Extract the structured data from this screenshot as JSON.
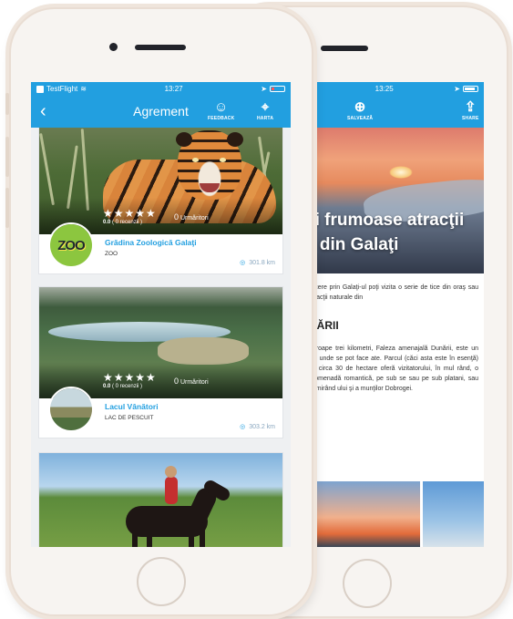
{
  "front": {
    "status": {
      "carrier": "TestFlight",
      "time": "13:27"
    },
    "nav": {
      "back_icon": "back-chevron-icon",
      "title": "Agrement",
      "feedback_label": "FEEDBACK",
      "map_label": "HARTA"
    },
    "cards": [
      {
        "title": "Grădina Zoologică Galaţi",
        "category": "ZOO",
        "distance": "301.8 km",
        "stars": "★★★★★",
        "rating": "0.0",
        "reviews": "( 0 recenzii )",
        "followers_count": "0",
        "followers_label": "Urmăritori",
        "logo_text": "ZOO"
      },
      {
        "title": "Lacul Vânători",
        "category": "LAC DE PESCUIT",
        "distance": "303.2 km",
        "stars": "★★★★★",
        "rating": "0.0",
        "reviews": "( 0 recenzii )",
        "followers_count": "0",
        "followers_label": "Urmăritori"
      }
    ]
  },
  "back": {
    "status": {
      "time": "13:25"
    },
    "nav": {
      "save_label": "SALVEAZĂ",
      "share_label": "SHARE"
    },
    "hero_title_line1": "ai frumoase atracţii",
    "hero_title_line2": "e din Galaţi",
    "intro": "recere prin Galaţi-ul poţi vizita o serie de tice din oraş sau atracţii naturale din",
    "section_heading": "NĂRII",
    "body": "aproape trei kilometri, Faleza amenajală Dunării, este un loc unde se pot face ate. Parcul (căci asta este în esenţă) cu circa 30 de hectare oferă vizitatorului, în mul rând, o promenadă romantică, pe sub se sau pe sub platani, sau admirând ului şi a munţilor Dobrogei."
  },
  "colors": {
    "accent": "#229fe0",
    "title_text": "#229fe0",
    "distance_text": "#8aa7bf"
  }
}
